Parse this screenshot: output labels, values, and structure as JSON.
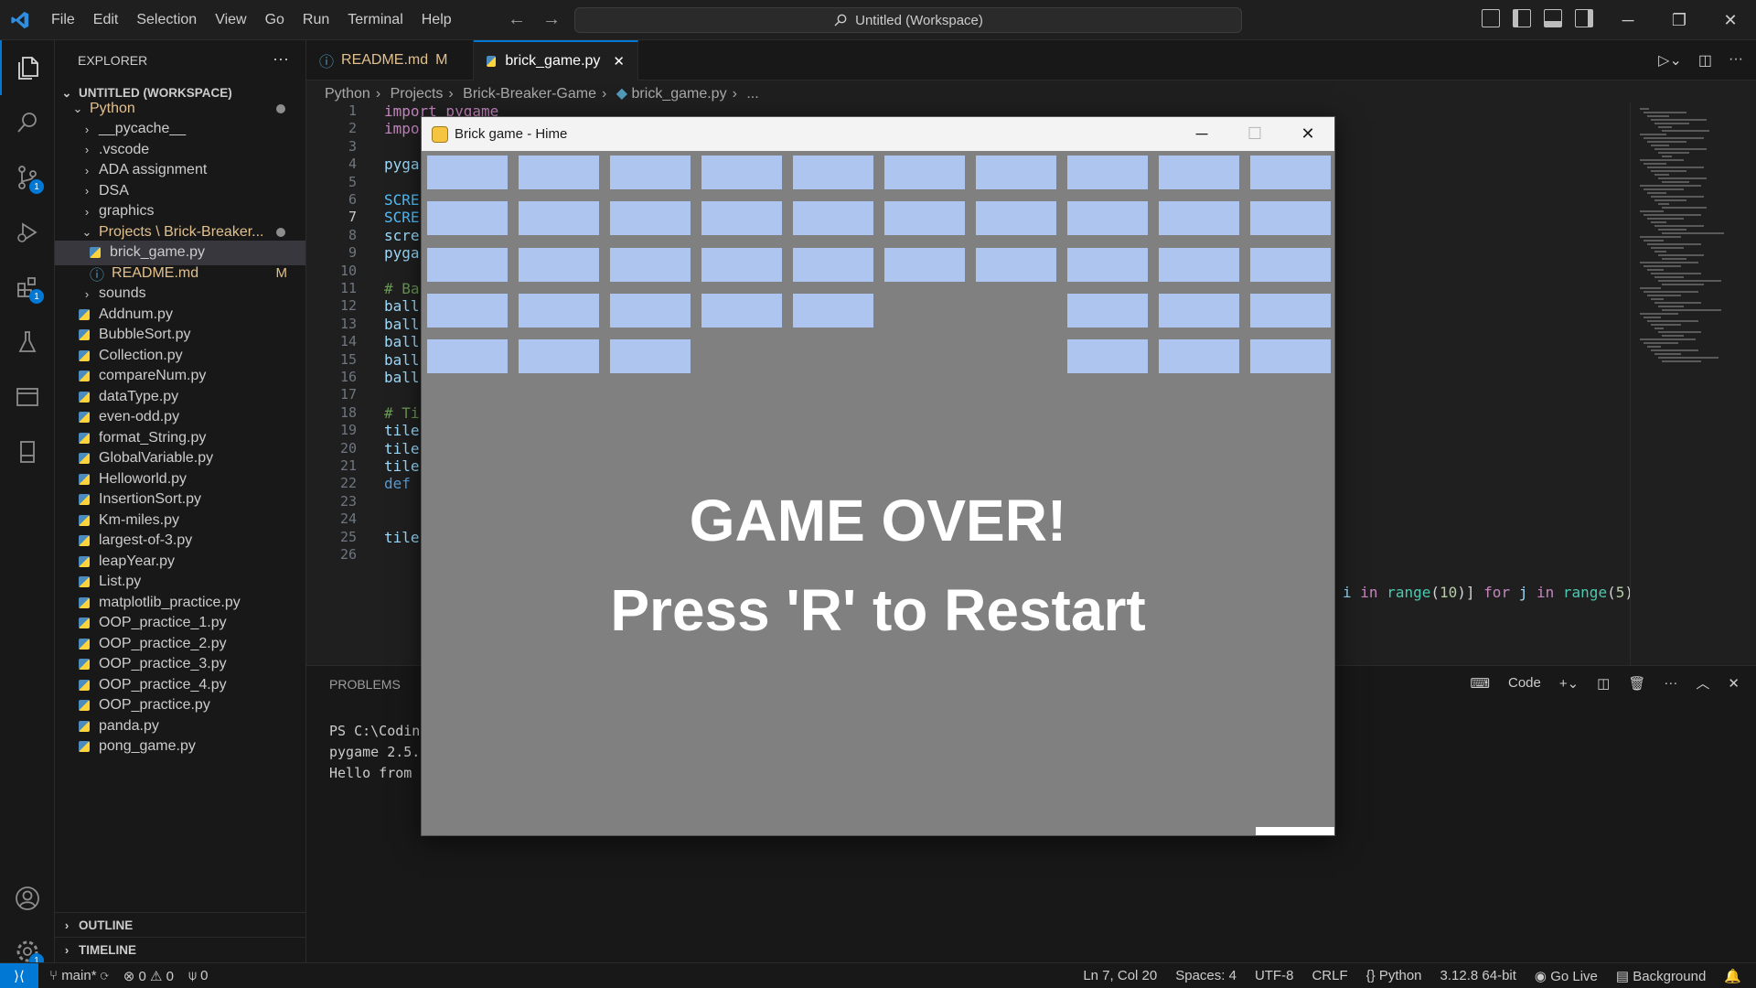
{
  "titlebar": {
    "menu": [
      "File",
      "Edit",
      "Selection",
      "View",
      "Go",
      "Run",
      "Terminal",
      "Help"
    ],
    "command_center": "Untitled (Workspace)"
  },
  "sidebar": {
    "title": "EXPLORER",
    "workspace": "UNTITLED (WORKSPACE)",
    "items": [
      {
        "label": "Python",
        "type": "folder-open",
        "depth": 0,
        "mod": "dot"
      },
      {
        "label": "__pycache__",
        "type": "folder",
        "depth": 1
      },
      {
        "label": ".vscode",
        "type": "folder",
        "depth": 1
      },
      {
        "label": "ADA assignment",
        "type": "folder",
        "depth": 1
      },
      {
        "label": "DSA",
        "type": "folder",
        "depth": 1
      },
      {
        "label": "graphics",
        "type": "folder",
        "depth": 1
      },
      {
        "label": "Projects \\ Brick-Breaker...",
        "type": "folder-open",
        "depth": 1,
        "mod": "dot"
      },
      {
        "label": "brick_game.py",
        "type": "py",
        "depth": 2,
        "selected": true
      },
      {
        "label": "README.md",
        "type": "info",
        "depth": 2,
        "mod": "M"
      },
      {
        "label": "sounds",
        "type": "folder",
        "depth": 1
      },
      {
        "label": "Addnum.py",
        "type": "py",
        "depth": 1
      },
      {
        "label": "BubbleSort.py",
        "type": "py",
        "depth": 1
      },
      {
        "label": "Collection.py",
        "type": "py",
        "depth": 1
      },
      {
        "label": "compareNum.py",
        "type": "py",
        "depth": 1
      },
      {
        "label": "dataType.py",
        "type": "py",
        "depth": 1
      },
      {
        "label": "even-odd.py",
        "type": "py",
        "depth": 1
      },
      {
        "label": "format_String.py",
        "type": "py",
        "depth": 1
      },
      {
        "label": "GlobalVariable.py",
        "type": "py",
        "depth": 1
      },
      {
        "label": "Helloworld.py",
        "type": "py",
        "depth": 1
      },
      {
        "label": "InsertionSort.py",
        "type": "py",
        "depth": 1
      },
      {
        "label": "Km-miles.py",
        "type": "py",
        "depth": 1
      },
      {
        "label": "largest-of-3.py",
        "type": "py",
        "depth": 1
      },
      {
        "label": "leapYear.py",
        "type": "py",
        "depth": 1
      },
      {
        "label": "List.py",
        "type": "py",
        "depth": 1
      },
      {
        "label": "matplotlib_practice.py",
        "type": "py",
        "depth": 1
      },
      {
        "label": "OOP_practice_1.py",
        "type": "py",
        "depth": 1
      },
      {
        "label": "OOP_practice_2.py",
        "type": "py",
        "depth": 1
      },
      {
        "label": "OOP_practice_3.py",
        "type": "py",
        "depth": 1
      },
      {
        "label": "OOP_practice_4.py",
        "type": "py",
        "depth": 1
      },
      {
        "label": "OOP_practice.py",
        "type": "py",
        "depth": 1
      },
      {
        "label": "panda.py",
        "type": "py",
        "depth": 1
      },
      {
        "label": "pong_game.py",
        "type": "py",
        "depth": 1
      }
    ],
    "outline": "OUTLINE",
    "timeline": "TIMELINE"
  },
  "tabs": [
    {
      "label": "README.md",
      "mod": "M",
      "icon": "info-icon"
    },
    {
      "label": "brick_game.py",
      "icon": "python-file-icon",
      "active": true
    }
  ],
  "breadcrumb": [
    "Python",
    "Projects",
    "Brick-Breaker-Game",
    "brick_game.py",
    "..."
  ],
  "code": {
    "line_numbers": [
      "1",
      "2",
      "3",
      "4",
      "5",
      "6",
      "7",
      "8",
      "9",
      "10",
      "11",
      "12",
      "13",
      "14",
      "15",
      "16",
      "17",
      "18",
      "19",
      "20",
      "21",
      "22",
      "23",
      "24",
      "25",
      "26"
    ],
    "current_line": "7",
    "visible_lines": [
      {
        "n": "1",
        "parts": [
          [
            "kw",
            "import pygame"
          ]
        ]
      },
      {
        "n": "2",
        "parts": [
          [
            "kw",
            "impo"
          ]
        ]
      },
      {
        "n": "4",
        "parts": [
          [
            "var",
            "pyga"
          ]
        ]
      },
      {
        "n": "6",
        "parts": [
          [
            "cst",
            "SCRE"
          ]
        ]
      },
      {
        "n": "7",
        "parts": [
          [
            "cst",
            "SCRE"
          ]
        ]
      },
      {
        "n": "8",
        "parts": [
          [
            "var",
            "scre"
          ]
        ]
      },
      {
        "n": "9",
        "parts": [
          [
            "var",
            "pyga"
          ]
        ]
      },
      {
        "n": "11",
        "parts": [
          [
            "cm",
            "# Ba"
          ]
        ]
      },
      {
        "n": "12",
        "parts": [
          [
            "var",
            "ball"
          ]
        ]
      },
      {
        "n": "13",
        "parts": [
          [
            "var",
            "ball"
          ]
        ]
      },
      {
        "n": "14",
        "parts": [
          [
            "var",
            "ball"
          ]
        ]
      },
      {
        "n": "15",
        "parts": [
          [
            "var",
            "ball"
          ]
        ]
      },
      {
        "n": "16",
        "parts": [
          [
            "var",
            "ball"
          ]
        ]
      },
      {
        "n": "18",
        "parts": [
          [
            "cm",
            "# Ti"
          ]
        ]
      },
      {
        "n": "19",
        "parts": [
          [
            "var",
            "tile"
          ]
        ]
      },
      {
        "n": "20",
        "parts": [
          [
            "var",
            "tile"
          ]
        ]
      },
      {
        "n": "21",
        "parts": [
          [
            "var",
            "tile"
          ]
        ]
      },
      {
        "n": "22",
        "parts": [
          [
            "def",
            "def"
          ]
        ]
      },
      {
        "n": "25",
        "parts": [
          [
            "var",
            "tile"
          ]
        ]
      }
    ],
    "line22_tail": "i in range(10)] for j in range(5)"
  },
  "panel": {
    "tab": "PROBLEMS",
    "terminal_name": "Code",
    "terminal_lines": [
      "PS C:\\Codin",
      "pygame 2.5.",
      "Hello from"
    ]
  },
  "statusbar": {
    "branch": "main*",
    "errors": "0",
    "warnings": "0",
    "ports": "0",
    "position": "Ln 7, Col 20",
    "spaces": "Spaces: 4",
    "encoding": "UTF-8",
    "eol": "CRLF",
    "language": "Python",
    "interpreter": "3.12.8 64-bit",
    "golive": "Go Live",
    "background": "Background"
  },
  "game": {
    "title": "Brick game - Hime",
    "line1": "GAME OVER!",
    "line2": "Press 'R' to Restart",
    "brick_rows": [
      [
        1,
        1,
        1,
        1,
        1,
        1,
        1,
        1,
        1,
        1
      ],
      [
        1,
        1,
        1,
        1,
        1,
        1,
        1,
        1,
        1,
        1
      ],
      [
        1,
        1,
        1,
        1,
        1,
        1,
        1,
        1,
        1,
        1
      ],
      [
        1,
        1,
        1,
        1,
        1,
        0,
        0,
        1,
        1,
        1
      ],
      [
        1,
        1,
        1,
        0,
        0,
        0,
        0,
        1,
        1,
        1
      ]
    ],
    "colors": {
      "brick": "#aec6ef",
      "background": "#808080",
      "paddle": "#ffffff"
    }
  },
  "badges": {
    "source_control": "1",
    "extensions": "1",
    "accounts": "1"
  }
}
